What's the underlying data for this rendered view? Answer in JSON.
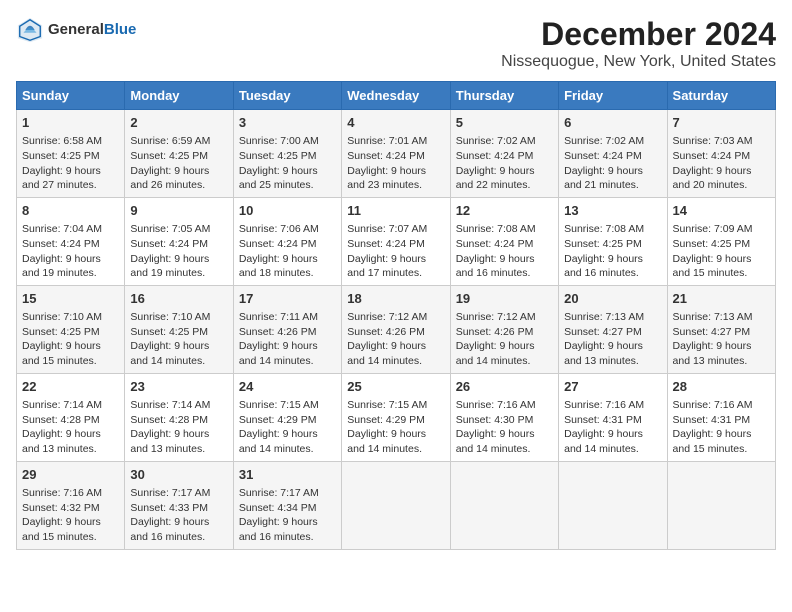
{
  "header": {
    "logo_general": "General",
    "logo_blue": "Blue",
    "title": "December 2024",
    "subtitle": "Nissequogue, New York, United States"
  },
  "calendar": {
    "days_of_week": [
      "Sunday",
      "Monday",
      "Tuesday",
      "Wednesday",
      "Thursday",
      "Friday",
      "Saturday"
    ],
    "weeks": [
      [
        {
          "day": "1",
          "info": "Sunrise: 6:58 AM\nSunset: 4:25 PM\nDaylight: 9 hours and 27 minutes."
        },
        {
          "day": "2",
          "info": "Sunrise: 6:59 AM\nSunset: 4:25 PM\nDaylight: 9 hours and 26 minutes."
        },
        {
          "day": "3",
          "info": "Sunrise: 7:00 AM\nSunset: 4:25 PM\nDaylight: 9 hours and 25 minutes."
        },
        {
          "day": "4",
          "info": "Sunrise: 7:01 AM\nSunset: 4:24 PM\nDaylight: 9 hours and 23 minutes."
        },
        {
          "day": "5",
          "info": "Sunrise: 7:02 AM\nSunset: 4:24 PM\nDaylight: 9 hours and 22 minutes."
        },
        {
          "day": "6",
          "info": "Sunrise: 7:02 AM\nSunset: 4:24 PM\nDaylight: 9 hours and 21 minutes."
        },
        {
          "day": "7",
          "info": "Sunrise: 7:03 AM\nSunset: 4:24 PM\nDaylight: 9 hours and 20 minutes."
        }
      ],
      [
        {
          "day": "8",
          "info": "Sunrise: 7:04 AM\nSunset: 4:24 PM\nDaylight: 9 hours and 19 minutes."
        },
        {
          "day": "9",
          "info": "Sunrise: 7:05 AM\nSunset: 4:24 PM\nDaylight: 9 hours and 19 minutes."
        },
        {
          "day": "10",
          "info": "Sunrise: 7:06 AM\nSunset: 4:24 PM\nDaylight: 9 hours and 18 minutes."
        },
        {
          "day": "11",
          "info": "Sunrise: 7:07 AM\nSunset: 4:24 PM\nDaylight: 9 hours and 17 minutes."
        },
        {
          "day": "12",
          "info": "Sunrise: 7:08 AM\nSunset: 4:24 PM\nDaylight: 9 hours and 16 minutes."
        },
        {
          "day": "13",
          "info": "Sunrise: 7:08 AM\nSunset: 4:25 PM\nDaylight: 9 hours and 16 minutes."
        },
        {
          "day": "14",
          "info": "Sunrise: 7:09 AM\nSunset: 4:25 PM\nDaylight: 9 hours and 15 minutes."
        }
      ],
      [
        {
          "day": "15",
          "info": "Sunrise: 7:10 AM\nSunset: 4:25 PM\nDaylight: 9 hours and 15 minutes."
        },
        {
          "day": "16",
          "info": "Sunrise: 7:10 AM\nSunset: 4:25 PM\nDaylight: 9 hours and 14 minutes."
        },
        {
          "day": "17",
          "info": "Sunrise: 7:11 AM\nSunset: 4:26 PM\nDaylight: 9 hours and 14 minutes."
        },
        {
          "day": "18",
          "info": "Sunrise: 7:12 AM\nSunset: 4:26 PM\nDaylight: 9 hours and 14 minutes."
        },
        {
          "day": "19",
          "info": "Sunrise: 7:12 AM\nSunset: 4:26 PM\nDaylight: 9 hours and 14 minutes."
        },
        {
          "day": "20",
          "info": "Sunrise: 7:13 AM\nSunset: 4:27 PM\nDaylight: 9 hours and 13 minutes."
        },
        {
          "day": "21",
          "info": "Sunrise: 7:13 AM\nSunset: 4:27 PM\nDaylight: 9 hours and 13 minutes."
        }
      ],
      [
        {
          "day": "22",
          "info": "Sunrise: 7:14 AM\nSunset: 4:28 PM\nDaylight: 9 hours and 13 minutes."
        },
        {
          "day": "23",
          "info": "Sunrise: 7:14 AM\nSunset: 4:28 PM\nDaylight: 9 hours and 13 minutes."
        },
        {
          "day": "24",
          "info": "Sunrise: 7:15 AM\nSunset: 4:29 PM\nDaylight: 9 hours and 14 minutes."
        },
        {
          "day": "25",
          "info": "Sunrise: 7:15 AM\nSunset: 4:29 PM\nDaylight: 9 hours and 14 minutes."
        },
        {
          "day": "26",
          "info": "Sunrise: 7:16 AM\nSunset: 4:30 PM\nDaylight: 9 hours and 14 minutes."
        },
        {
          "day": "27",
          "info": "Sunrise: 7:16 AM\nSunset: 4:31 PM\nDaylight: 9 hours and 14 minutes."
        },
        {
          "day": "28",
          "info": "Sunrise: 7:16 AM\nSunset: 4:31 PM\nDaylight: 9 hours and 15 minutes."
        }
      ],
      [
        {
          "day": "29",
          "info": "Sunrise: 7:16 AM\nSunset: 4:32 PM\nDaylight: 9 hours and 15 minutes."
        },
        {
          "day": "30",
          "info": "Sunrise: 7:17 AM\nSunset: 4:33 PM\nDaylight: 9 hours and 16 minutes."
        },
        {
          "day": "31",
          "info": "Sunrise: 7:17 AM\nSunset: 4:34 PM\nDaylight: 9 hours and 16 minutes."
        },
        null,
        null,
        null,
        null
      ]
    ]
  }
}
